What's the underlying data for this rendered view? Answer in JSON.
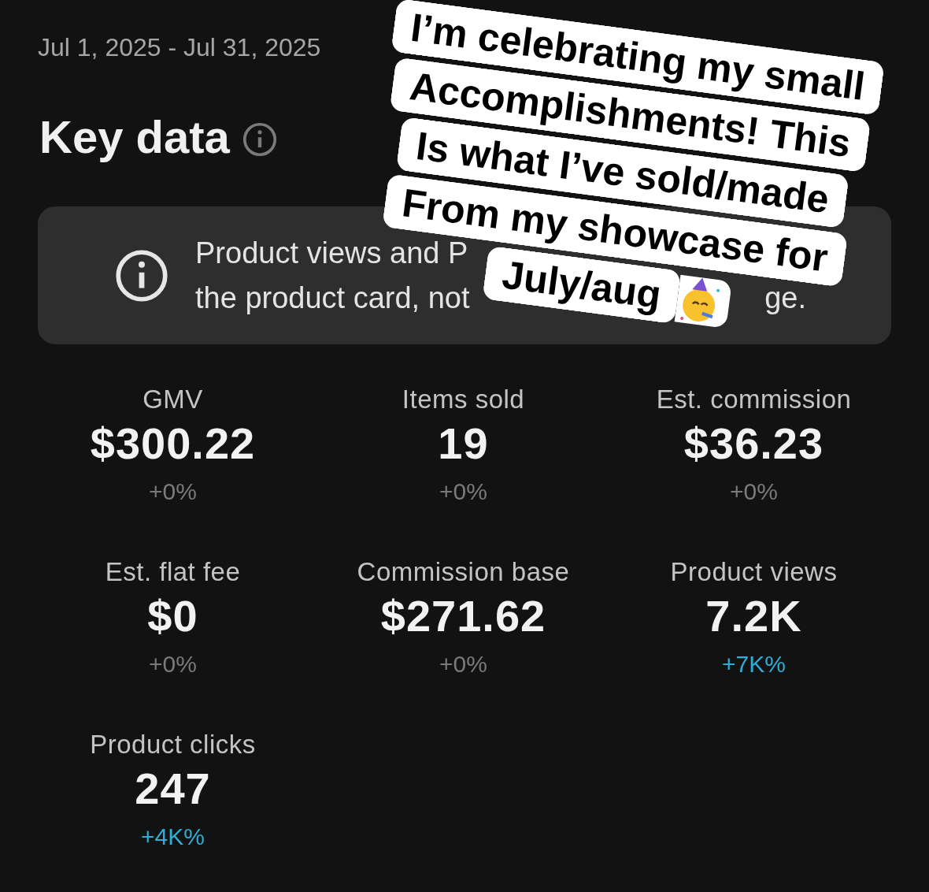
{
  "date_range": "Jul 1, 2025 - Jul 31, 2025",
  "heading": "Key data",
  "notice": {
    "line_1": "Product views and P",
    "line_2": "the product card, not",
    "line_2_end": "ge."
  },
  "metrics": [
    {
      "label": "GMV",
      "value": "$300.22",
      "change": "+0%",
      "highlighted": false
    },
    {
      "label": "Items sold",
      "value": "19",
      "change": "+0%",
      "highlighted": false
    },
    {
      "label": "Est. commission",
      "value": "$36.23",
      "change": "+0%",
      "highlighted": false
    },
    {
      "label": "Est. flat fee",
      "value": "$0",
      "change": "+0%",
      "highlighted": false
    },
    {
      "label": "Commission base",
      "value": "$271.62",
      "change": "+0%",
      "highlighted": false
    },
    {
      "label": "Product views",
      "value": "7.2K",
      "change": "+7K%",
      "highlighted": true
    },
    {
      "label": "Product clicks",
      "value": "247",
      "change": "+4K%",
      "highlighted": true
    }
  ],
  "caption": {
    "lines": [
      "I’m celebrating my small",
      "Accomplishments! This",
      "Is what I’ve sold/made",
      "From my showcase for",
      "July/aug"
    ]
  }
}
